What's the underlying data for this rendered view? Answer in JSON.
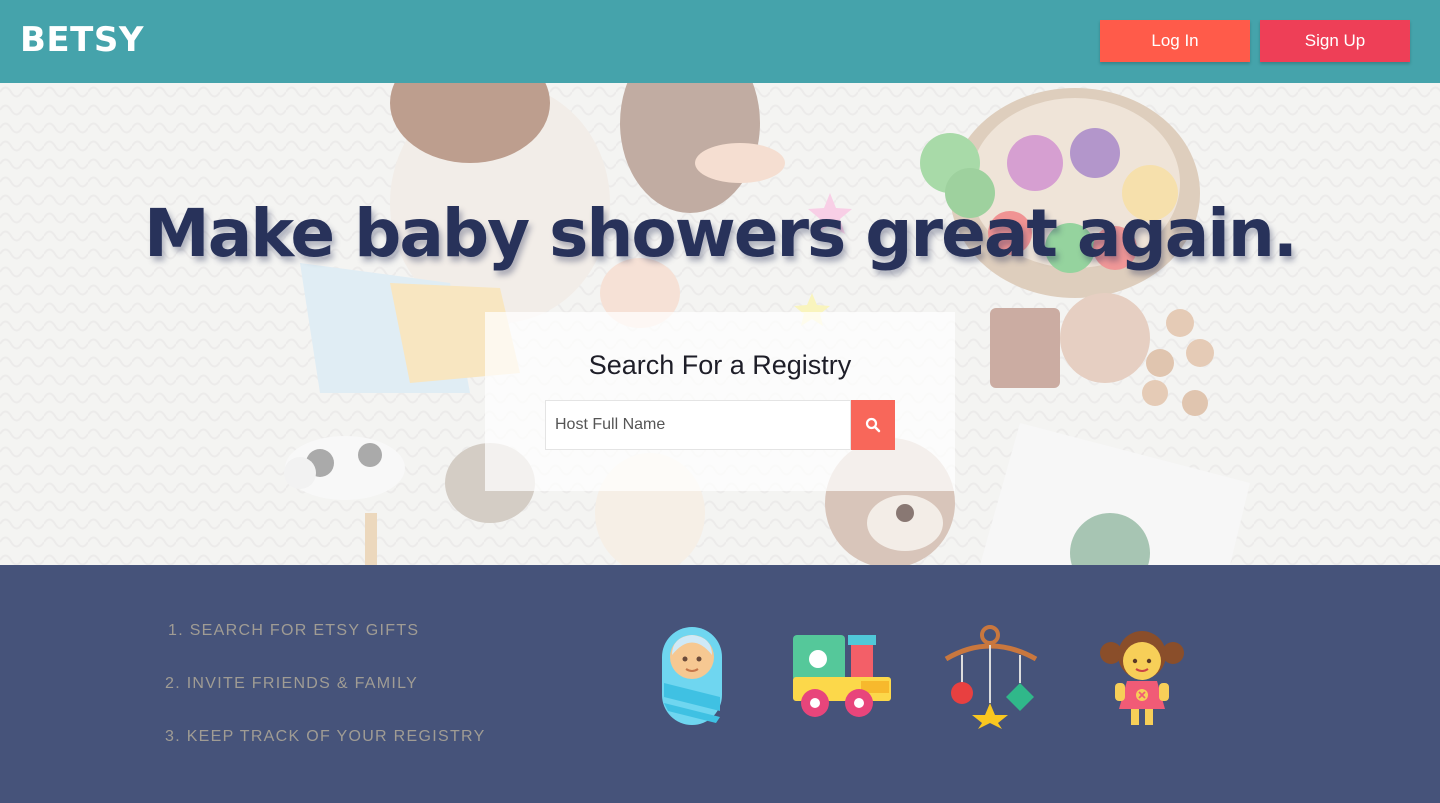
{
  "header": {
    "logo": "BETSY",
    "login_label": "Log In",
    "signup_label": "Sign Up"
  },
  "hero": {
    "headline": "Make baby showers great again.",
    "search_title": "Search For a Registry",
    "search_placeholder": "Host Full Name",
    "search_value": ""
  },
  "steps": [
    {
      "label": "1. SEARCH FOR ETSY GIFTS"
    },
    {
      "label": "2. INVITE FRIENDS & FAMILY"
    },
    {
      "label": "3. KEEP TRACK OF YOUR REGISTRY"
    }
  ],
  "icons": [
    "swaddled-baby-icon",
    "toy-train-icon",
    "baby-mobile-icon",
    "doll-icon"
  ],
  "colors": {
    "header_bg": "#45a3ab",
    "login_bg": "#ff5b4a",
    "signup_bg": "#ee3f57",
    "footer_bg": "#46537a",
    "headline": "#28325a",
    "search_button": "#f8675a"
  }
}
